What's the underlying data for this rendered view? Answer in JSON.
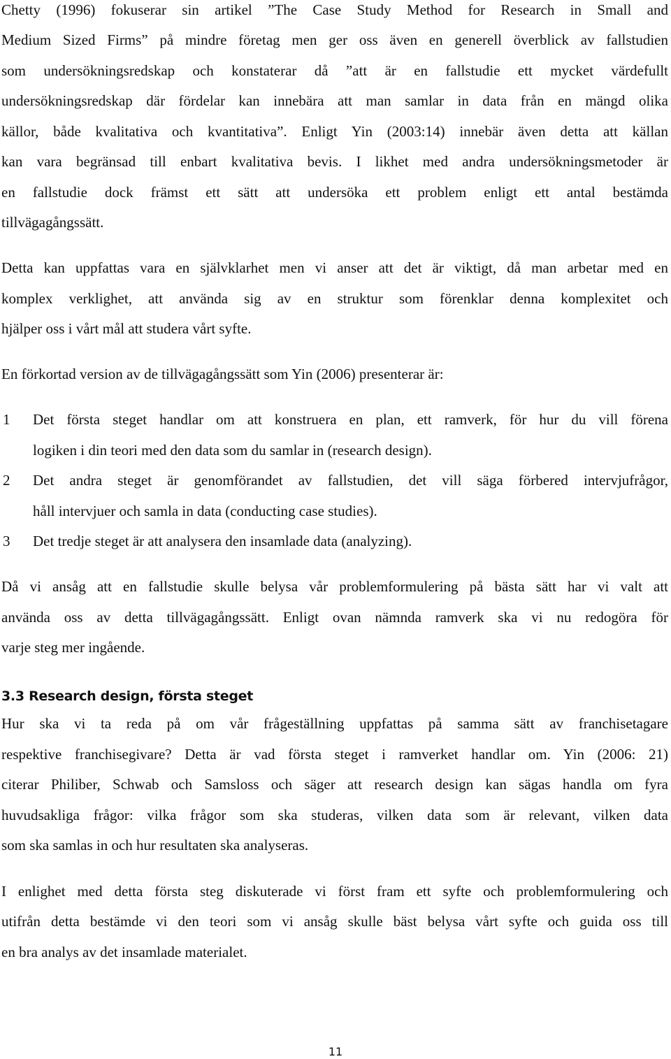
{
  "document": {
    "paragraphs": [
      {
        "lines": [
          "Chetty (1996) fokuserar sin artikel ”The Case Study Method for Research in Small and",
          "Medium Sized Firms” på mindre företag men ger oss även en generell överblick av fallstudien",
          "som undersökningsredskap och konstaterar då ”att är en fallstudie ett mycket värdefullt",
          "undersökningsredskap där fördelar kan innebära att man samlar in data från en mängd olika",
          "källor, både kvalitativa och kvantitativa”. Enligt Yin (2003:14)  innebär även detta att källan",
          "kan vara begränsad till enbart kvalitativa bevis. I likhet med andra undersökningsmetoder är",
          "en fallstudie dock främst ett sätt att undersöka ett problem enligt ett antal bestämda",
          "tillvägagångssätt."
        ]
      },
      {
        "lines": [
          "Detta kan uppfattas vara en självklarhet men vi anser att det är viktigt, då man arbetar med en",
          "komplex verklighet, att använda sig av en struktur som förenklar denna komplexitet och",
          "hjälper oss i vårt mål att studera vårt syfte."
        ]
      },
      {
        "lines": [
          "En förkortad version av de tillvägagångssätt som Yin (2006) presenterar är:"
        ]
      }
    ],
    "steps": [
      {
        "number": "1",
        "lines": [
          "Det första steget handlar om att konstruera en plan, ett ramverk, för hur du vill förena",
          "logiken i din teori med den data som du samlar in (research design)."
        ]
      },
      {
        "number": "2",
        "lines": [
          "Det andra steget är genomförandet av fallstudien, det vill säga förbered intervjufrågor,",
          "håll intervjuer och samla in data (conducting case studies)."
        ]
      },
      {
        "number": "3",
        "lines": [
          "Det tredje steget är att analysera den insamlade data (analyzing)."
        ]
      }
    ],
    "after_steps": {
      "lines": [
        "Då vi ansåg att en fallstudie skulle belysa vår problemformulering på bästa sätt har vi valt att",
        "använda oss av detta tillvägagångssätt. Enligt ovan nämnda ramverk ska vi nu redogöra för",
        "varje steg mer ingående."
      ]
    },
    "section_heading": "3.3 Research design, första steget",
    "section_paragraphs": [
      {
        "lines": [
          "Hur ska vi ta reda på om vår frågeställning uppfattas på samma sätt av franchisetagare",
          "respektive franchisegivare? Detta är vad första steget i ramverket handlar om. Yin (2006: 21)",
          "citerar Philiber, Schwab och Samsloss och säger att research design kan sägas handla om fyra",
          "huvudsakliga frågor: vilka frågor som ska studeras, vilken data som är relevant, vilken data",
          "som ska samlas in och hur resultaten ska analyseras."
        ]
      },
      {
        "lines": [
          "I enlighet med detta första steg diskuterade vi först fram ett syfte och problemformulering och",
          "utifrån detta bestämde vi den teori som vi ansåg skulle bäst belysa vårt syfte och guida oss till",
          "en bra analys av det insamlade materialet."
        ]
      }
    ],
    "page_number": "11"
  }
}
